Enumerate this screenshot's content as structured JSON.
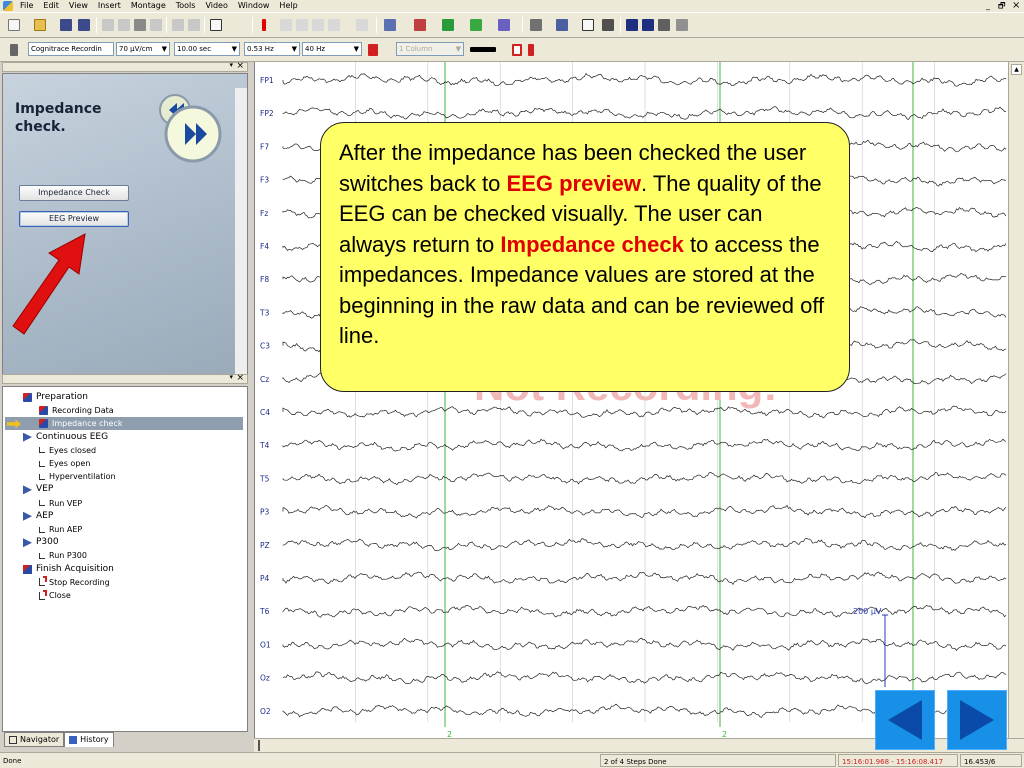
{
  "menu": [
    "File",
    "Edit",
    "View",
    "Insert",
    "Montage",
    "Tools",
    "Video",
    "Window",
    "Help"
  ],
  "window_controls": {
    "minimize": "_",
    "restore": "🗗",
    "close": "×"
  },
  "toolbar2": {
    "recording_select": "Cognitrace Recordin",
    "sensitivity": "70 µV/cm",
    "timebase": "10.00 sec",
    "lowpass": "0.53 Hz",
    "highpass": "40 Hz",
    "layout": "1 Column",
    "color_swatch": "#000000"
  },
  "wizard": {
    "title": "Impedance check.",
    "buttons": [
      "Impedance Check",
      "EEG Preview"
    ],
    "active_button": "EEG Preview"
  },
  "pane_controls": {
    "pin": "▾",
    "close": "×"
  },
  "navigator": {
    "items": [
      {
        "label": "Preparation",
        "level": 0,
        "icon": "wand-icon"
      },
      {
        "label": "Recording Data",
        "level": 1,
        "icon": "wand-icon"
      },
      {
        "label": "Impedance check",
        "level": 1,
        "icon": "wand-icon",
        "current": true
      },
      {
        "label": "Continuous EEG",
        "level": 0,
        "icon": "triangle-icon"
      },
      {
        "label": "Eyes closed",
        "level": 1,
        "icon": "step-icon"
      },
      {
        "label": "Eyes open",
        "level": 1,
        "icon": "step-icon"
      },
      {
        "label": "Hyperventilation",
        "level": 1,
        "icon": "step-icon"
      },
      {
        "label": "VEP",
        "level": 0,
        "icon": "triangle-icon"
      },
      {
        "label": "Run VEP",
        "level": 1,
        "icon": "step-icon"
      },
      {
        "label": "AEP",
        "level": 0,
        "icon": "triangle-icon"
      },
      {
        "label": "Run AEP",
        "level": 1,
        "icon": "step-icon"
      },
      {
        "label": "P300",
        "level": 0,
        "icon": "triangle-icon"
      },
      {
        "label": "Run P300",
        "level": 1,
        "icon": "step-icon"
      },
      {
        "label": "Finish Acquisition",
        "level": 0,
        "icon": "finish-icon"
      },
      {
        "label": "Stop Recording",
        "level": 1,
        "icon": "stop-icon"
      },
      {
        "label": "Close",
        "level": 1,
        "icon": "stop-icon"
      }
    ],
    "tabs": [
      "Navigator",
      "History"
    ]
  },
  "eeg": {
    "channels": [
      "FP1",
      "FP2",
      "F7",
      "F3",
      "Fz",
      "F4",
      "F8",
      "T3",
      "C3",
      "Cz",
      "C4",
      "T4",
      "T5",
      "P3",
      "PZ",
      "P4",
      "T6",
      "O1",
      "Oz",
      "O2"
    ],
    "markers": [
      "2",
      "2"
    ],
    "scale_label": "200 µV",
    "watermark": "Not Recording!",
    "trace_color": "#222222",
    "marker_color": "#3cb83c",
    "grid_color": "#c8c8c8"
  },
  "callout": {
    "t1": "After the impedance has been checked the user switches back to ",
    "h1": "EEG preview",
    "t2": ". The quality of the EEG can be checked visually. The user can always return to ",
    "h2": "Impedance check",
    "t3": " to access the impedances. Impedance values are stored at the beginning in the raw data and can be reviewed off line."
  },
  "status": {
    "left": "Done",
    "steps": "2 of 4 Steps Done",
    "time_range": "15:16:01.968 - 15:16:08.417",
    "position": "16.453/6"
  },
  "slide_nav": {
    "prev": "◀",
    "next": "▶"
  }
}
